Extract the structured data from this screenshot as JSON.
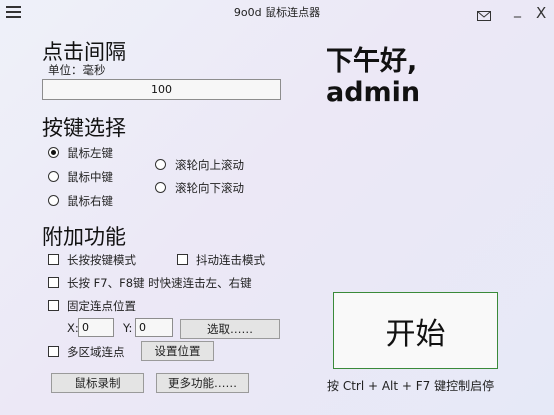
{
  "window": {
    "title": "9o0d 鼠标连点器",
    "minimize": "_",
    "close": "X"
  },
  "interval": {
    "heading": "点击间隔",
    "unit_label": "单位：毫秒",
    "value": "100"
  },
  "keys": {
    "heading": "按键选择",
    "options": [
      "鼠标左键",
      "鼠标中键",
      "鼠标右键",
      "滚轮向上滚动",
      "滚轮向下滚动"
    ],
    "selected": "鼠标左键"
  },
  "extra": {
    "heading": "附加功能",
    "long_press_mode": "长按按键模式",
    "jitter_mode": "抖动连击模式",
    "f7_f8": "长按 F7、F8键 时快速连击左、右键",
    "fixed_position": "固定连点位置",
    "x_label": "X:",
    "x_value": "0",
    "y_label": "Y:",
    "y_value": "0",
    "pick_button": "选取……",
    "multi_area": "多区域连点",
    "set_position_button": "设置位置"
  },
  "bottom": {
    "record_button": "鼠标录制",
    "more_button": "更多功能……"
  },
  "greeting": {
    "line1": "下午好,",
    "line2": "admin"
  },
  "start": {
    "label": "开始",
    "hint": "按 Ctrl + Alt + F7 键控制启停"
  },
  "colors": {
    "start_border": "#3a8a3a",
    "background": "#eceaf7"
  }
}
